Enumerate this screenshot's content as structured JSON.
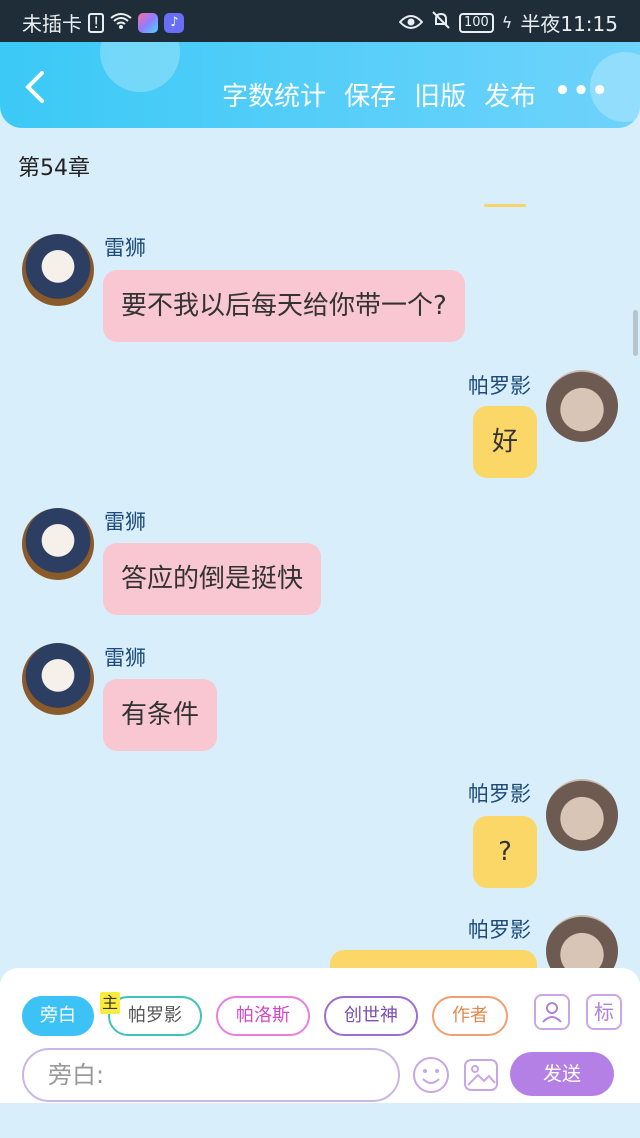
{
  "status_bar": {
    "carrier": "未插卡",
    "battery": "100",
    "time": "半夜11:15",
    "icons": [
      "sim-alert-icon",
      "wifi-icon",
      "app-icon",
      "music-app-icon",
      "eye-icon",
      "mute-bell-icon",
      "battery-icon",
      "charging-icon"
    ]
  },
  "header": {
    "back_icon": "chevron-left-icon",
    "actions": [
      "字数统计",
      "保存",
      "旧版",
      "发布"
    ],
    "more": "•••"
  },
  "chapter_title": "第54章",
  "messages": [
    {
      "side": "left",
      "name": "雷狮",
      "text": "要不我以后每天给你带一个?"
    },
    {
      "side": "right",
      "name": "帕罗影",
      "text": "好"
    },
    {
      "side": "left",
      "name": "雷狮",
      "text": "答应的倒是挺快"
    },
    {
      "side": "left",
      "name": "雷狮",
      "text": "有条件"
    },
    {
      "side": "right",
      "name": "帕罗影",
      "text": "?"
    },
    {
      "side": "right",
      "name": "帕罗影",
      "text": ""
    }
  ],
  "roles": {
    "narration": "旁白",
    "main_tag": "主",
    "list": [
      "帕罗影",
      "帕洛斯",
      "创世神",
      "作者"
    ]
  },
  "tools": {
    "profile_icon": "person-card-icon",
    "tag_label": "标"
  },
  "composer": {
    "placeholder": "旁白:",
    "send_label": "发送"
  },
  "colors": {
    "header": "#3bc9f6",
    "background": "#d8eefa",
    "left_bubble": "#f9c7d1",
    "right_bubble": "#fbd768",
    "send": "#b580e6"
  }
}
